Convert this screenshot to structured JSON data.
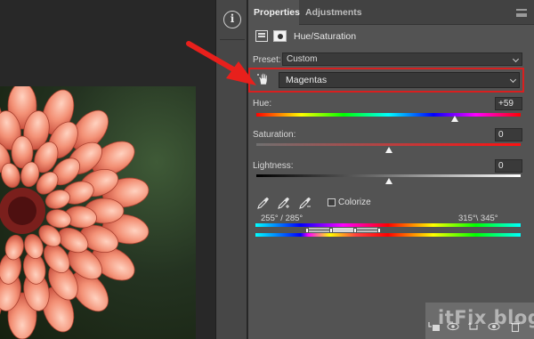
{
  "window": {
    "tabs": [
      {
        "label": "Properties",
        "active": true
      },
      {
        "label": "Adjustments",
        "active": false
      }
    ]
  },
  "toolbar": {
    "info_icon": "i"
  },
  "adjustment": {
    "title": "Hue/Saturation",
    "preset_label": "Preset:",
    "preset_value": "Custom",
    "channel_value": "Magentas"
  },
  "sliders": {
    "hue": {
      "label": "Hue:",
      "value": "+59",
      "level": 0.75
    },
    "saturation": {
      "label": "Saturation:",
      "value": "0",
      "level": 0.5
    },
    "lightness": {
      "label": "Lightness:",
      "value": "0",
      "level": 0.5
    }
  },
  "colorize": {
    "label": "Colorize",
    "checked": false
  },
  "range": {
    "left": "255° / 285°",
    "right": "315°\\ 345°"
  },
  "watermark": "itFix blog",
  "colors": {
    "panel": "#535353",
    "highlight": "#d91f1f",
    "arrow": "#e8201c"
  },
  "icons": [
    "info-icon",
    "hand-tool-icon",
    "eyedropper-icon",
    "eyedropper-add-icon",
    "eyedropper-subtract-icon",
    "clip-to-layer-icon",
    "view-previous-icon",
    "reset-icon",
    "visibility-icon",
    "trash-icon"
  ]
}
